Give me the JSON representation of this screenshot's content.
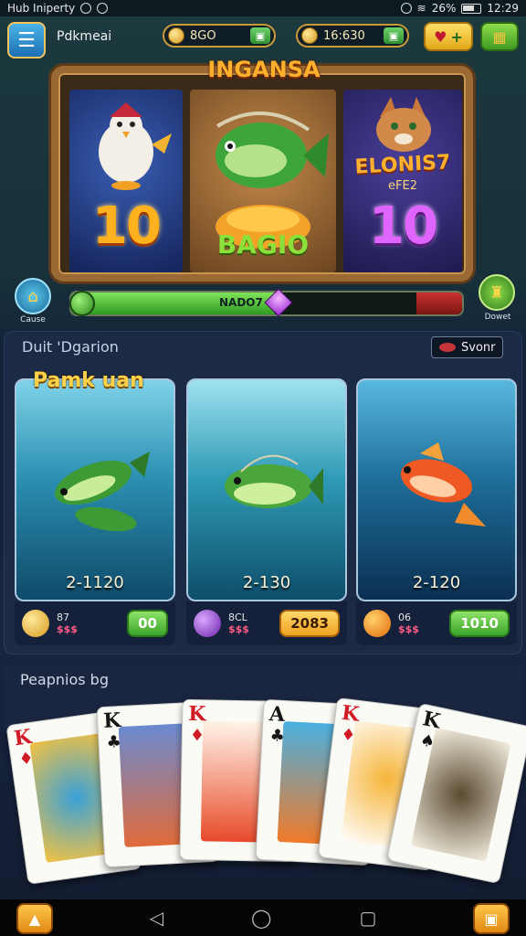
{
  "status_bar": {
    "left_text": "Hub Iniperty",
    "signal": "26%",
    "time": "12:29"
  },
  "header": {
    "back_icon": "back-arrow-icon",
    "player_name": "Pdkmeai",
    "currency_1": "8GO",
    "currency_2": "16:630",
    "heart_plus": "+"
  },
  "slot": {
    "title": "INGANSA",
    "left_value": "10",
    "center_word": "BAGIO",
    "right_label": "ELONIS7",
    "right_sub": "eFE2",
    "right_value": "10"
  },
  "progress": {
    "label": "NADO7",
    "fraction": 0.52,
    "left_label": "Cause",
    "right_label": "Dowet"
  },
  "section": {
    "title": "Duit 'Dgarion",
    "season_label": "Svonr",
    "cards_heading": "Pamk uan"
  },
  "fish_cards": [
    {
      "range": "2-1120",
      "meta1": "87",
      "meta2": "$$$",
      "button": "00",
      "button_style": "green",
      "icon_color": "#d69a1e"
    },
    {
      "range": "2-130",
      "meta1": "8CL",
      "meta2": "$$$",
      "button": "2083",
      "button_style": "orange",
      "icon_color": "#8a3ad0"
    },
    {
      "range": "2-120",
      "meta1": "06",
      "meta2": "$$$",
      "button": "1010",
      "button_style": "green",
      "icon_color": "#f08a10"
    }
  ],
  "bottom": {
    "title": "Peapnios bg"
  },
  "playing_cards": [
    {
      "rank": "K",
      "suit": "♦",
      "color": "red"
    },
    {
      "rank": "K",
      "suit": "♣",
      "color": "black"
    },
    {
      "rank": "K",
      "suit": "♦",
      "color": "red"
    },
    {
      "rank": "A",
      "suit": "♣",
      "color": "black"
    },
    {
      "rank": "K",
      "suit": "♦",
      "color": "red"
    },
    {
      "rank": "K",
      "suit": "♠",
      "color": "black"
    }
  ],
  "nav": {
    "back": "◁",
    "home": "◯",
    "recent": "▢"
  }
}
